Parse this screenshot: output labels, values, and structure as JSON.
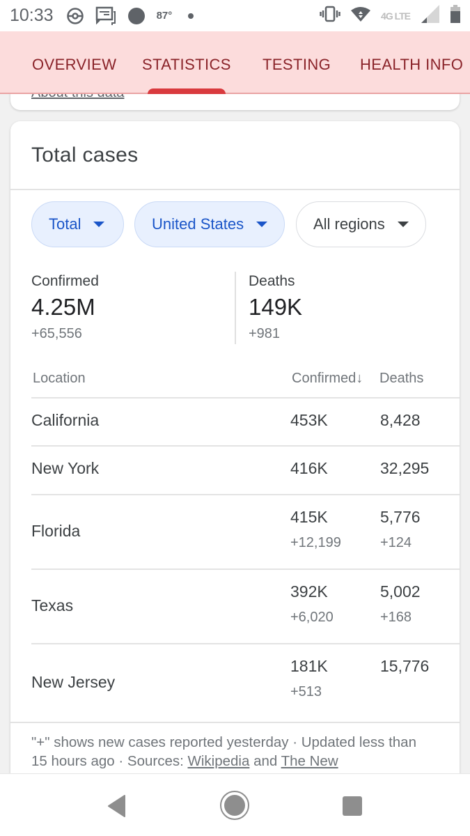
{
  "status_bar": {
    "time": "10:33",
    "temperature": "87°",
    "icons_left": [
      "pokeball-icon",
      "messages-icon",
      "circle-icon",
      "dot-icon"
    ],
    "network": "4G LTE",
    "icons_right": [
      "vibrate-icon",
      "wifi-icon",
      "signal-icon",
      "battery-icon"
    ]
  },
  "tabs": [
    {
      "label": "OVERVIEW",
      "active": false
    },
    {
      "label": "STATISTICS",
      "active": true
    },
    {
      "label": "TESTING",
      "active": false
    },
    {
      "label": "HEALTH INFO",
      "active": false
    }
  ],
  "prev_card": {
    "link": "About this data"
  },
  "card": {
    "title": "Total cases",
    "filters": {
      "metric": "Total",
      "country": "United States",
      "region": "All regions"
    },
    "summary": {
      "confirmed": {
        "label": "Confirmed",
        "value": "4.25M",
        "delta": "+65,556"
      },
      "deaths": {
        "label": "Deaths",
        "value": "149K",
        "delta": "+981"
      }
    },
    "table": {
      "headers": {
        "location": "Location",
        "confirmed": "Confirmed",
        "sort_arrow": "↓",
        "deaths": "Deaths"
      },
      "rows": [
        {
          "location": "California",
          "confirmed": "453K",
          "confirmed_delta": "",
          "deaths": "8,428",
          "deaths_delta": ""
        },
        {
          "location": "New York",
          "confirmed": "416K",
          "confirmed_delta": "",
          "deaths": "32,295",
          "deaths_delta": ""
        },
        {
          "location": "Florida",
          "confirmed": "415K",
          "confirmed_delta": "+12,199",
          "deaths": "5,776",
          "deaths_delta": "+124"
        },
        {
          "location": "Texas",
          "confirmed": "392K",
          "confirmed_delta": "+6,020",
          "deaths": "5,002",
          "deaths_delta": "+168"
        },
        {
          "location": "New Jersey",
          "confirmed": "181K",
          "confirmed_delta": "+513",
          "deaths": "15,776",
          "deaths_delta": ""
        }
      ]
    },
    "footnote": {
      "line1": "\"+\" shows new cases reported yesterday · Updated less than 15 hours ago  ·  Sources: ",
      "link1": "Wikipedia",
      "and": " and ",
      "link2": "The New"
    }
  },
  "colors": {
    "tab_bg": "#fcdcdc",
    "tab_text": "#8a2329",
    "tab_indicator": "#d93a3e",
    "chip_blue_bg": "#e8f0fe",
    "chip_blue_text": "#1a55c8"
  }
}
